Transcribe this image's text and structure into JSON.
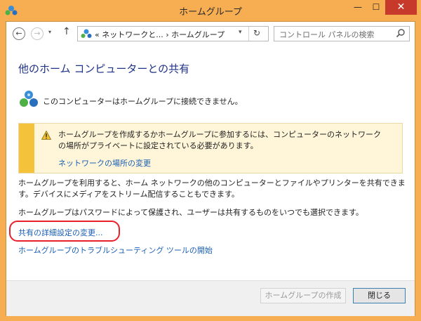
{
  "window": {
    "title": "ホームグループ",
    "controls": {
      "minimize": "—",
      "maximize": "☐",
      "close": "✕"
    }
  },
  "nav": {
    "back": "←",
    "forward": "→",
    "recent": "▾",
    "up": "↑",
    "address": "« ネットワークと... › ホームグループ",
    "address_dropdown": "▾",
    "refresh": "↻",
    "search_placeholder": "コントロール パネルの検索"
  },
  "main": {
    "heading": "他のホーム コンピューターとの共有",
    "status": "このコンピューターはホームグループに接続できません。",
    "warning": {
      "text": "ホームグループを作成するかホームグループに参加するには、コンピューターのネットワークの場所がプライベートに設定されている必要があります。",
      "link": "ネットワークの場所の変更"
    },
    "paragraph1": "ホームグループを利用すると、ホーム ネットワークの他のコンピューターとファイルやプリンターを共有できます。デバイスにメディアをストリーム配信することもできます。",
    "paragraph2": "ホームグループはパスワードによって保護され、ユーザーは共有するものをいつでも選択できます。",
    "link_advanced": "共有の詳細設定の変更...",
    "link_troubleshoot": "ホームグループのトラブルシューティング ツールの開始"
  },
  "footer": {
    "create_button": "ホームグループの作成",
    "close_button": "閉じる"
  },
  "colors": {
    "frame": "#f7ae52",
    "close_button": "#c7392b",
    "heading": "#1e3287",
    "link": "#1a5fb4",
    "highlight": "#e8202a",
    "warning_bar": "#f5c23c"
  }
}
